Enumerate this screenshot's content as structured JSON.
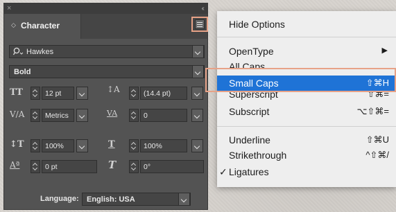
{
  "panel": {
    "close_glyph": "×",
    "collapse_glyph": "‹‹",
    "tab_arrows": "◇",
    "tab_label": "Character",
    "font_family": "Hawkes",
    "font_style": "Bold",
    "font_size": "12 pt",
    "leading": "(14.4 pt)",
    "kerning": "Metrics",
    "tracking": "0",
    "vertical_scale": "100%",
    "horizontal_scale": "100%",
    "baseline_shift": "0 pt",
    "rotation": "0°",
    "language_label": "Language:",
    "language_value": "English: USA"
  },
  "menu": {
    "hide_options": "Hide Options",
    "opentype": "OpenType",
    "opentype_arrow": "▶",
    "all_caps": "All Caps",
    "small_caps": "Small Caps",
    "small_caps_shortcut": "⇧⌘H",
    "superscript": "Superscript",
    "superscript_shortcut": "⇧⌘=",
    "subscript": "Subscript",
    "subscript_shortcut": "⌥⇧⌘=",
    "underline": "Underline",
    "underline_shortcut": "⇧⌘U",
    "strikethrough": "Strikethrough",
    "strikethrough_shortcut": "^⇧⌘/",
    "ligatures_check": "✓",
    "ligatures": "Ligatures"
  },
  "colors": {
    "panel_bg": "#535353",
    "menu_bg": "#eeeeee",
    "selection_blue": "#1f73d6",
    "highlight_outline": "#e7a287"
  }
}
